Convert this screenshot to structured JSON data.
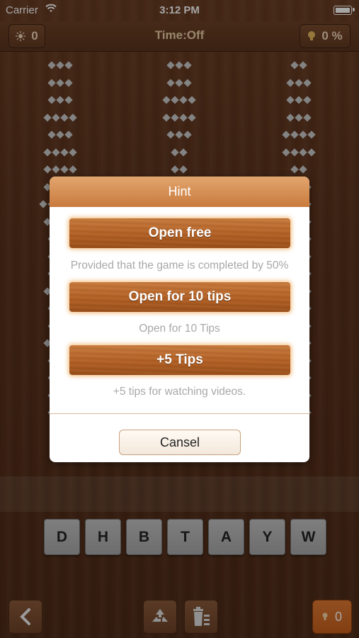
{
  "status_bar": {
    "carrier": "Carrier",
    "time": "3:12 PM"
  },
  "top_bar": {
    "score_value": "0",
    "time_label": "Time:Off",
    "progress_value": "0 %"
  },
  "dialog": {
    "title": "Hint",
    "option1_label": "Open free",
    "option1_desc": "Provided that the game is completed by 50%",
    "option2_label": "Open for 10 tips",
    "option2_desc": "Open for 10 Tips",
    "option3_label": "+5 Tips",
    "option3_desc": "+5 tips for watching videos.",
    "cancel_label": "Cansel"
  },
  "letters": [
    "D",
    "H",
    "B",
    "T",
    "A",
    "Y",
    "W"
  ],
  "bottom_bar": {
    "hints_count": "0"
  },
  "icons": {
    "score": "sun-icon",
    "progress": "bulb-icon",
    "back": "chevron-left-icon",
    "shuffle": "shuffle-icon",
    "trash": "trash-icon",
    "hint": "bulb-icon"
  }
}
